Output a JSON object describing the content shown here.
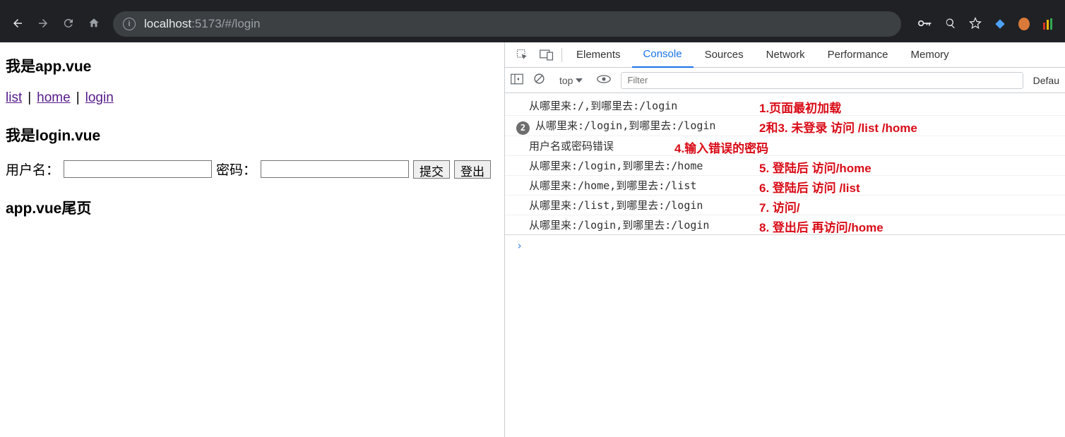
{
  "browser": {
    "url_host": "localhost",
    "url_port": ":5173",
    "url_path": "/#/login"
  },
  "page": {
    "heading_app": "我是app.vue",
    "nav": {
      "list": "list",
      "home": "home",
      "login": "login"
    },
    "heading_login": "我是login.vue",
    "form": {
      "user_label": "用户名：",
      "pass_label": "密码：",
      "submit": "提交",
      "logout": "登出"
    },
    "footer": "app.vue尾页"
  },
  "devtools": {
    "tabs": {
      "elements": "Elements",
      "console": "Console",
      "sources": "Sources",
      "network": "Network",
      "performance": "Performance",
      "memory": "Memory"
    },
    "subbar": {
      "context": "top",
      "filter_placeholder": "Filter",
      "levels": "Defau"
    },
    "rows": [
      {
        "badge": "",
        "msg": "从哪里来:/,到哪里去:/login",
        "ann": "1.页面最初加载"
      },
      {
        "badge": "2",
        "msg": "从哪里来:/login,到哪里去:/login",
        "ann": "2和3. 未登录 访问 /list /home"
      },
      {
        "badge": "",
        "msg": "用户名或密码错误",
        "ann": "4.输入错误的密码"
      },
      {
        "badge": "",
        "msg": "从哪里来:/login,到哪里去:/home",
        "ann": "5. 登陆后 访问/home"
      },
      {
        "badge": "",
        "msg": "从哪里来:/home,到哪里去:/list",
        "ann": "6. 登陆后 访问 /list"
      },
      {
        "badge": "",
        "msg": "从哪里来:/list,到哪里去:/login",
        "ann": "7. 访问/"
      },
      {
        "badge": "",
        "msg": "从哪里来:/login,到哪里去:/login",
        "ann": "8. 登出后 再访问/home"
      }
    ],
    "prompt": "›"
  }
}
